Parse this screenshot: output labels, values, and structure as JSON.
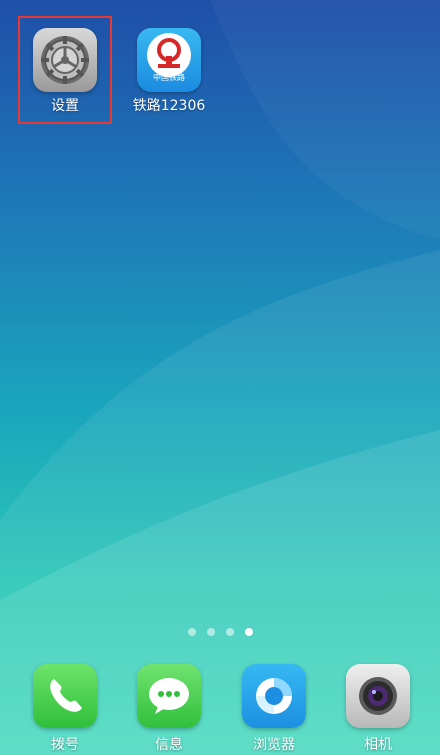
{
  "home_screen": {
    "apps": [
      {
        "label": "设置",
        "icon": "settings-gear-icon",
        "highlighted": true
      },
      {
        "label": "铁路12306",
        "icon": "china-railway-icon",
        "badge_text": "中国铁路"
      }
    ]
  },
  "page_indicator": {
    "count": 4,
    "active_index": 4
  },
  "dock": {
    "apps": [
      {
        "label": "拨号",
        "icon": "phone-icon"
      },
      {
        "label": "信息",
        "icon": "message-icon"
      },
      {
        "label": "浏览器",
        "icon": "browser-icon"
      },
      {
        "label": "相机",
        "icon": "camera-icon"
      }
    ]
  },
  "colors": {
    "highlight_border": "#e53935",
    "railway_red": "#d62828",
    "phone_green": "#37c63f",
    "browser_blue": "#1d8fe2"
  }
}
